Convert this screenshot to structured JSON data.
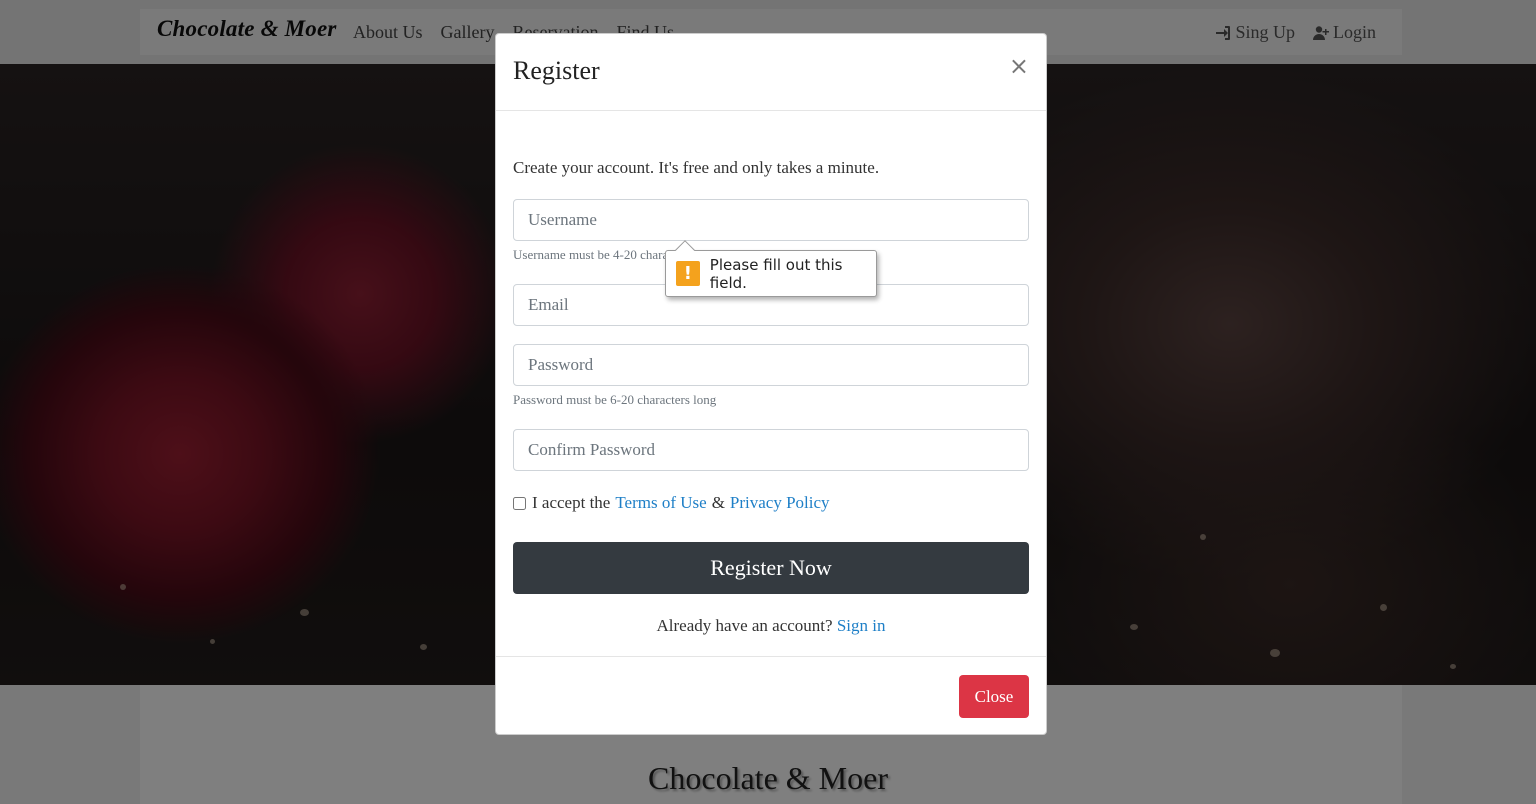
{
  "navbar": {
    "brand": "Chocolate & Moer",
    "links": [
      "About Us",
      "Gallery",
      "Reservation",
      "Find Us"
    ],
    "signup_label": "Sing Up",
    "login_label": "Login"
  },
  "page": {
    "section_title": "Chocolate & Moer"
  },
  "modal": {
    "title": "Register",
    "close_symbol": "×",
    "intro": "Create your account. It's free and only takes a minute.",
    "username": {
      "placeholder": "Username",
      "hint": "Username must be 4-20 characters long"
    },
    "email": {
      "placeholder": "Email"
    },
    "password": {
      "placeholder": "Password",
      "hint": "Password must be 6-20 characters long"
    },
    "confirm_password": {
      "placeholder": "Confirm Password"
    },
    "accept": {
      "prefix": "I accept the",
      "terms": "Terms of Use",
      "amp": "&",
      "privacy": "Privacy Policy"
    },
    "register_label": "Register Now",
    "signin_prompt": "Already have an account?",
    "signin_link": "Sign in",
    "close_button": "Close"
  },
  "tooltip": {
    "icon": "!",
    "message": "Please fill out this field."
  },
  "colors": {
    "register_button": "#343a40",
    "close_button": "#dc3545",
    "link": "#1e7fc7",
    "warning": "#f4a21d"
  }
}
